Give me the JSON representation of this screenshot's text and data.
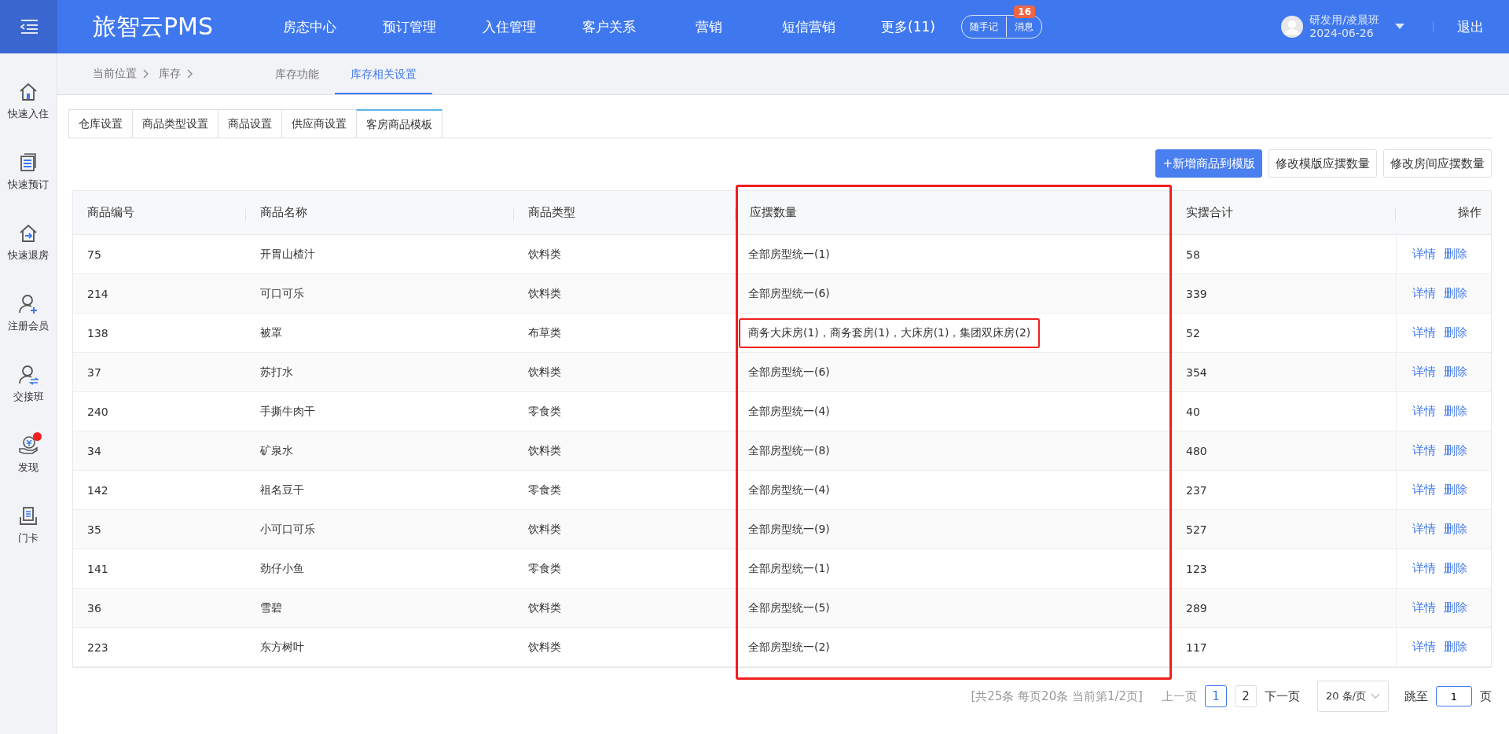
{
  "header": {
    "logo": "旅智云PMS",
    "nav": [
      {
        "label": "房态中心",
        "selected": false
      },
      {
        "label": "预订管理",
        "selected": false
      },
      {
        "label": "入住管理",
        "selected": false
      },
      {
        "label": "客户关系",
        "selected": false
      },
      {
        "label": "营销",
        "selected": false
      },
      {
        "label": "短信营销",
        "selected": false
      },
      {
        "label": "更多(11)",
        "selected": false
      }
    ],
    "quick_buttons": [
      "随手记",
      "消息"
    ],
    "message_badge": "16",
    "user": {
      "name": "研发用/凌晨班",
      "date": "2024-06-26"
    },
    "logout": "退出"
  },
  "sidebar": {
    "items": [
      {
        "label": "快速入住",
        "dot": false
      },
      {
        "label": "快速预订",
        "dot": false
      },
      {
        "label": "快速退房",
        "dot": false
      },
      {
        "label": "注册会员",
        "dot": false
      },
      {
        "label": "交接班",
        "dot": false
      },
      {
        "label": "发现",
        "dot": true
      },
      {
        "label": "门卡",
        "dot": false
      }
    ]
  },
  "breadcrumb": [
    "当前位置",
    "库存"
  ],
  "page_tabs": [
    {
      "label": "库存功能",
      "selected": false
    },
    {
      "label": "库存相关设置",
      "selected": true
    }
  ],
  "sub_tabs": [
    {
      "label": "仓库设置",
      "selected": false
    },
    {
      "label": "商品类型设置",
      "selected": false
    },
    {
      "label": "商品设置",
      "selected": false
    },
    {
      "label": "供应商设置",
      "selected": false
    },
    {
      "label": "客房商品模板",
      "selected": true
    }
  ],
  "actions": [
    {
      "label": "+新增商品到模版",
      "primary": true
    },
    {
      "label": "修改模版应摆数量",
      "primary": false
    },
    {
      "label": "修改房间应摆数量",
      "primary": false
    }
  ],
  "table": {
    "columns": [
      {
        "label": "商品编号",
        "highlighted": false
      },
      {
        "label": "商品名称",
        "highlighted": false
      },
      {
        "label": "商品类型",
        "highlighted": false
      },
      {
        "label": "应摆数量",
        "highlighted": true
      },
      {
        "label": "实摆合计",
        "highlighted": false
      },
      {
        "label": "操作",
        "highlighted": false
      }
    ],
    "rows": [
      {
        "id": "75",
        "name": "开胃山楂汁",
        "type": "饮料类",
        "quantity": "全部房型统一(1)",
        "total": "58",
        "highlighted": false,
        "actions": [
          "详情",
          "删除"
        ]
      },
      {
        "id": "214",
        "name": "可口可乐",
        "type": "饮料类",
        "quantity": "全部房型统一(6)",
        "total": "339",
        "highlighted": false,
        "actions": [
          "详情",
          "删除"
        ]
      },
      {
        "id": "138",
        "name": "被罩",
        "type": "布草类",
        "quantity": "商务大床房(1)，商务套房(1)，大床房(1)，集团双床房(2)",
        "total": "52",
        "highlighted": true,
        "actions": [
          "详情",
          "删除"
        ]
      },
      {
        "id": "37",
        "name": "苏打水",
        "type": "饮料类",
        "quantity": "全部房型统一(6)",
        "total": "354",
        "highlighted": false,
        "actions": [
          "详情",
          "删除"
        ]
      },
      {
        "id": "240",
        "name": "手撕牛肉干",
        "type": "零食类",
        "quantity": "全部房型统一(4)",
        "total": "40",
        "highlighted": false,
        "actions": [
          "详情",
          "删除"
        ]
      },
      {
        "id": "34",
        "name": "矿泉水",
        "type": "饮料类",
        "quantity": "全部房型统一(8)",
        "total": "480",
        "highlighted": false,
        "actions": [
          "详情",
          "删除"
        ]
      },
      {
        "id": "142",
        "name": "祖名豆干",
        "type": "零食类",
        "quantity": "全部房型统一(4)",
        "total": "237",
        "highlighted": false,
        "actions": [
          "详情",
          "删除"
        ]
      },
      {
        "id": "35",
        "name": "小可口可乐",
        "type": "饮料类",
        "quantity": "全部房型统一(9)",
        "total": "527",
        "highlighted": false,
        "actions": [
          "详情",
          "删除"
        ]
      },
      {
        "id": "141",
        "name": "劲仔小鱼",
        "type": "零食类",
        "quantity": "全部房型统一(1)",
        "total": "123",
        "highlighted": false,
        "actions": [
          "详情",
          "删除"
        ]
      },
      {
        "id": "36",
        "name": "雪碧",
        "type": "饮料类",
        "quantity": "全部房型统一(5)",
        "total": "289",
        "highlighted": false,
        "actions": [
          "详情",
          "删除"
        ]
      },
      {
        "id": "223",
        "name": "东方树叶",
        "type": "饮料类",
        "quantity": "全部房型统一(2)",
        "total": "117",
        "highlighted": false,
        "actions": [
          "详情",
          "删除"
        ]
      }
    ]
  },
  "pagination": {
    "summary": "[共25条 每页20条 当前第1/2页]",
    "prev": "上一页",
    "pages": [
      {
        "label": "1",
        "selected": true
      },
      {
        "label": "2",
        "selected": false
      }
    ],
    "next": "下一页",
    "page_size": "20 条/页",
    "jump_label": "跳至",
    "jump_value": "1",
    "page_unit": "页"
  }
}
